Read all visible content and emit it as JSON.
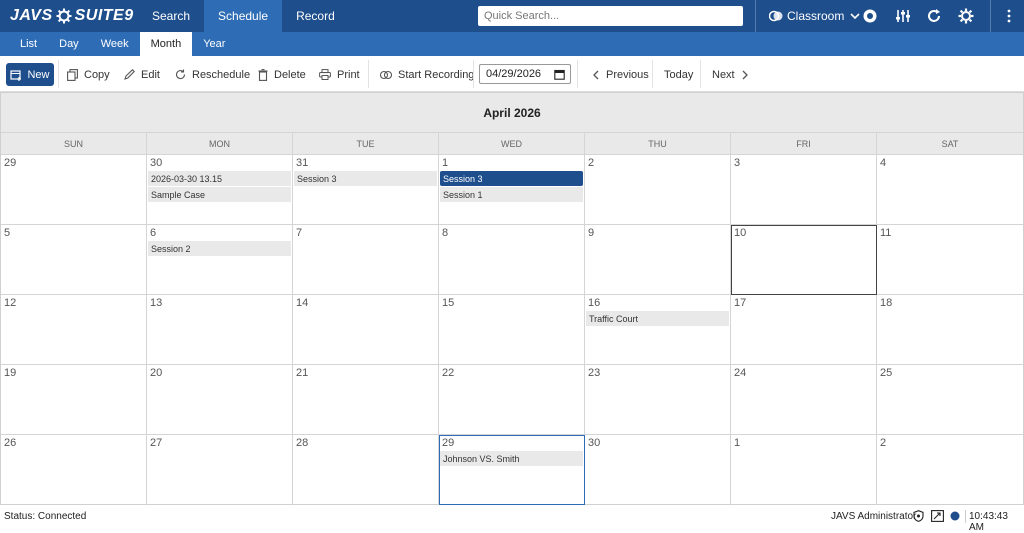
{
  "app": {
    "logo_left": "JAVS",
    "logo_right": "SUITE9"
  },
  "nav": {
    "items": [
      {
        "label": "Search",
        "active": false
      },
      {
        "label": "Schedule",
        "active": true
      },
      {
        "label": "Record",
        "active": false
      }
    ]
  },
  "search": {
    "placeholder": "Quick Search..."
  },
  "room": {
    "label": "Classroom"
  },
  "top_icons": [
    "record-icon",
    "mixer-icon",
    "sync-icon",
    "settings-icon",
    "more-vertical-icon"
  ],
  "subtabs": [
    {
      "label": "List",
      "active": false
    },
    {
      "label": "Day",
      "active": false
    },
    {
      "label": "Week",
      "active": false
    },
    {
      "label": "Month",
      "active": true
    },
    {
      "label": "Year",
      "active": false
    }
  ],
  "toolbar": {
    "new": "New",
    "copy": "Copy",
    "edit": "Edit",
    "reschedule": "Reschedule",
    "delete": "Delete",
    "print": "Print",
    "start_recording": "Start Recording",
    "date_value": "04/29/2026",
    "previous": "Previous",
    "today": "Today",
    "next": "Next"
  },
  "calendar": {
    "title": "April 2026",
    "days_of_week": [
      "SUN",
      "MON",
      "TUE",
      "WED",
      "THU",
      "FRI",
      "SAT"
    ],
    "weeks": [
      [
        {
          "num": "29",
          "events": []
        },
        {
          "num": "30",
          "events": [
            {
              "label": "2026-03-30 13.15",
              "active": false
            },
            {
              "label": "Sample Case",
              "active": false
            }
          ]
        },
        {
          "num": "31",
          "events": [
            {
              "label": "Session 3",
              "active": false
            }
          ]
        },
        {
          "num": "1",
          "events": [
            {
              "label": "Session 3",
              "active": true
            },
            {
              "label": "Session 1",
              "active": false
            }
          ]
        },
        {
          "num": "2",
          "events": []
        },
        {
          "num": "3",
          "events": []
        },
        {
          "num": "4",
          "events": []
        }
      ],
      [
        {
          "num": "5",
          "events": []
        },
        {
          "num": "6",
          "events": [
            {
              "label": "Session 2",
              "active": false
            }
          ]
        },
        {
          "num": "7",
          "events": []
        },
        {
          "num": "8",
          "events": []
        },
        {
          "num": "9",
          "events": []
        },
        {
          "num": "10",
          "events": [],
          "today": true
        },
        {
          "num": "11",
          "events": []
        }
      ],
      [
        {
          "num": "12",
          "events": []
        },
        {
          "num": "13",
          "events": []
        },
        {
          "num": "14",
          "events": []
        },
        {
          "num": "15",
          "events": []
        },
        {
          "num": "16",
          "events": [
            {
              "label": "Traffic Court",
              "active": false
            }
          ]
        },
        {
          "num": "17",
          "events": []
        },
        {
          "num": "18",
          "events": []
        }
      ],
      [
        {
          "num": "19",
          "events": []
        },
        {
          "num": "20",
          "events": []
        },
        {
          "num": "21",
          "events": []
        },
        {
          "num": "22",
          "events": []
        },
        {
          "num": "23",
          "events": []
        },
        {
          "num": "24",
          "events": []
        },
        {
          "num": "25",
          "events": []
        }
      ],
      [
        {
          "num": "26",
          "events": []
        },
        {
          "num": "27",
          "events": []
        },
        {
          "num": "28",
          "events": []
        },
        {
          "num": "29",
          "events": [
            {
              "label": "Johnson VS. Smith",
              "active": false
            }
          ],
          "selected": true
        },
        {
          "num": "30",
          "events": []
        },
        {
          "num": "1",
          "events": []
        },
        {
          "num": "2",
          "events": []
        }
      ]
    ]
  },
  "status": {
    "connection": "Status: Connected",
    "user": "JAVS Administrator",
    "time": "10:43:43 AM"
  },
  "colors": {
    "primary": "#1e4e8c",
    "secondary": "#2e6db5",
    "header_bg": "#e9e9ea"
  }
}
